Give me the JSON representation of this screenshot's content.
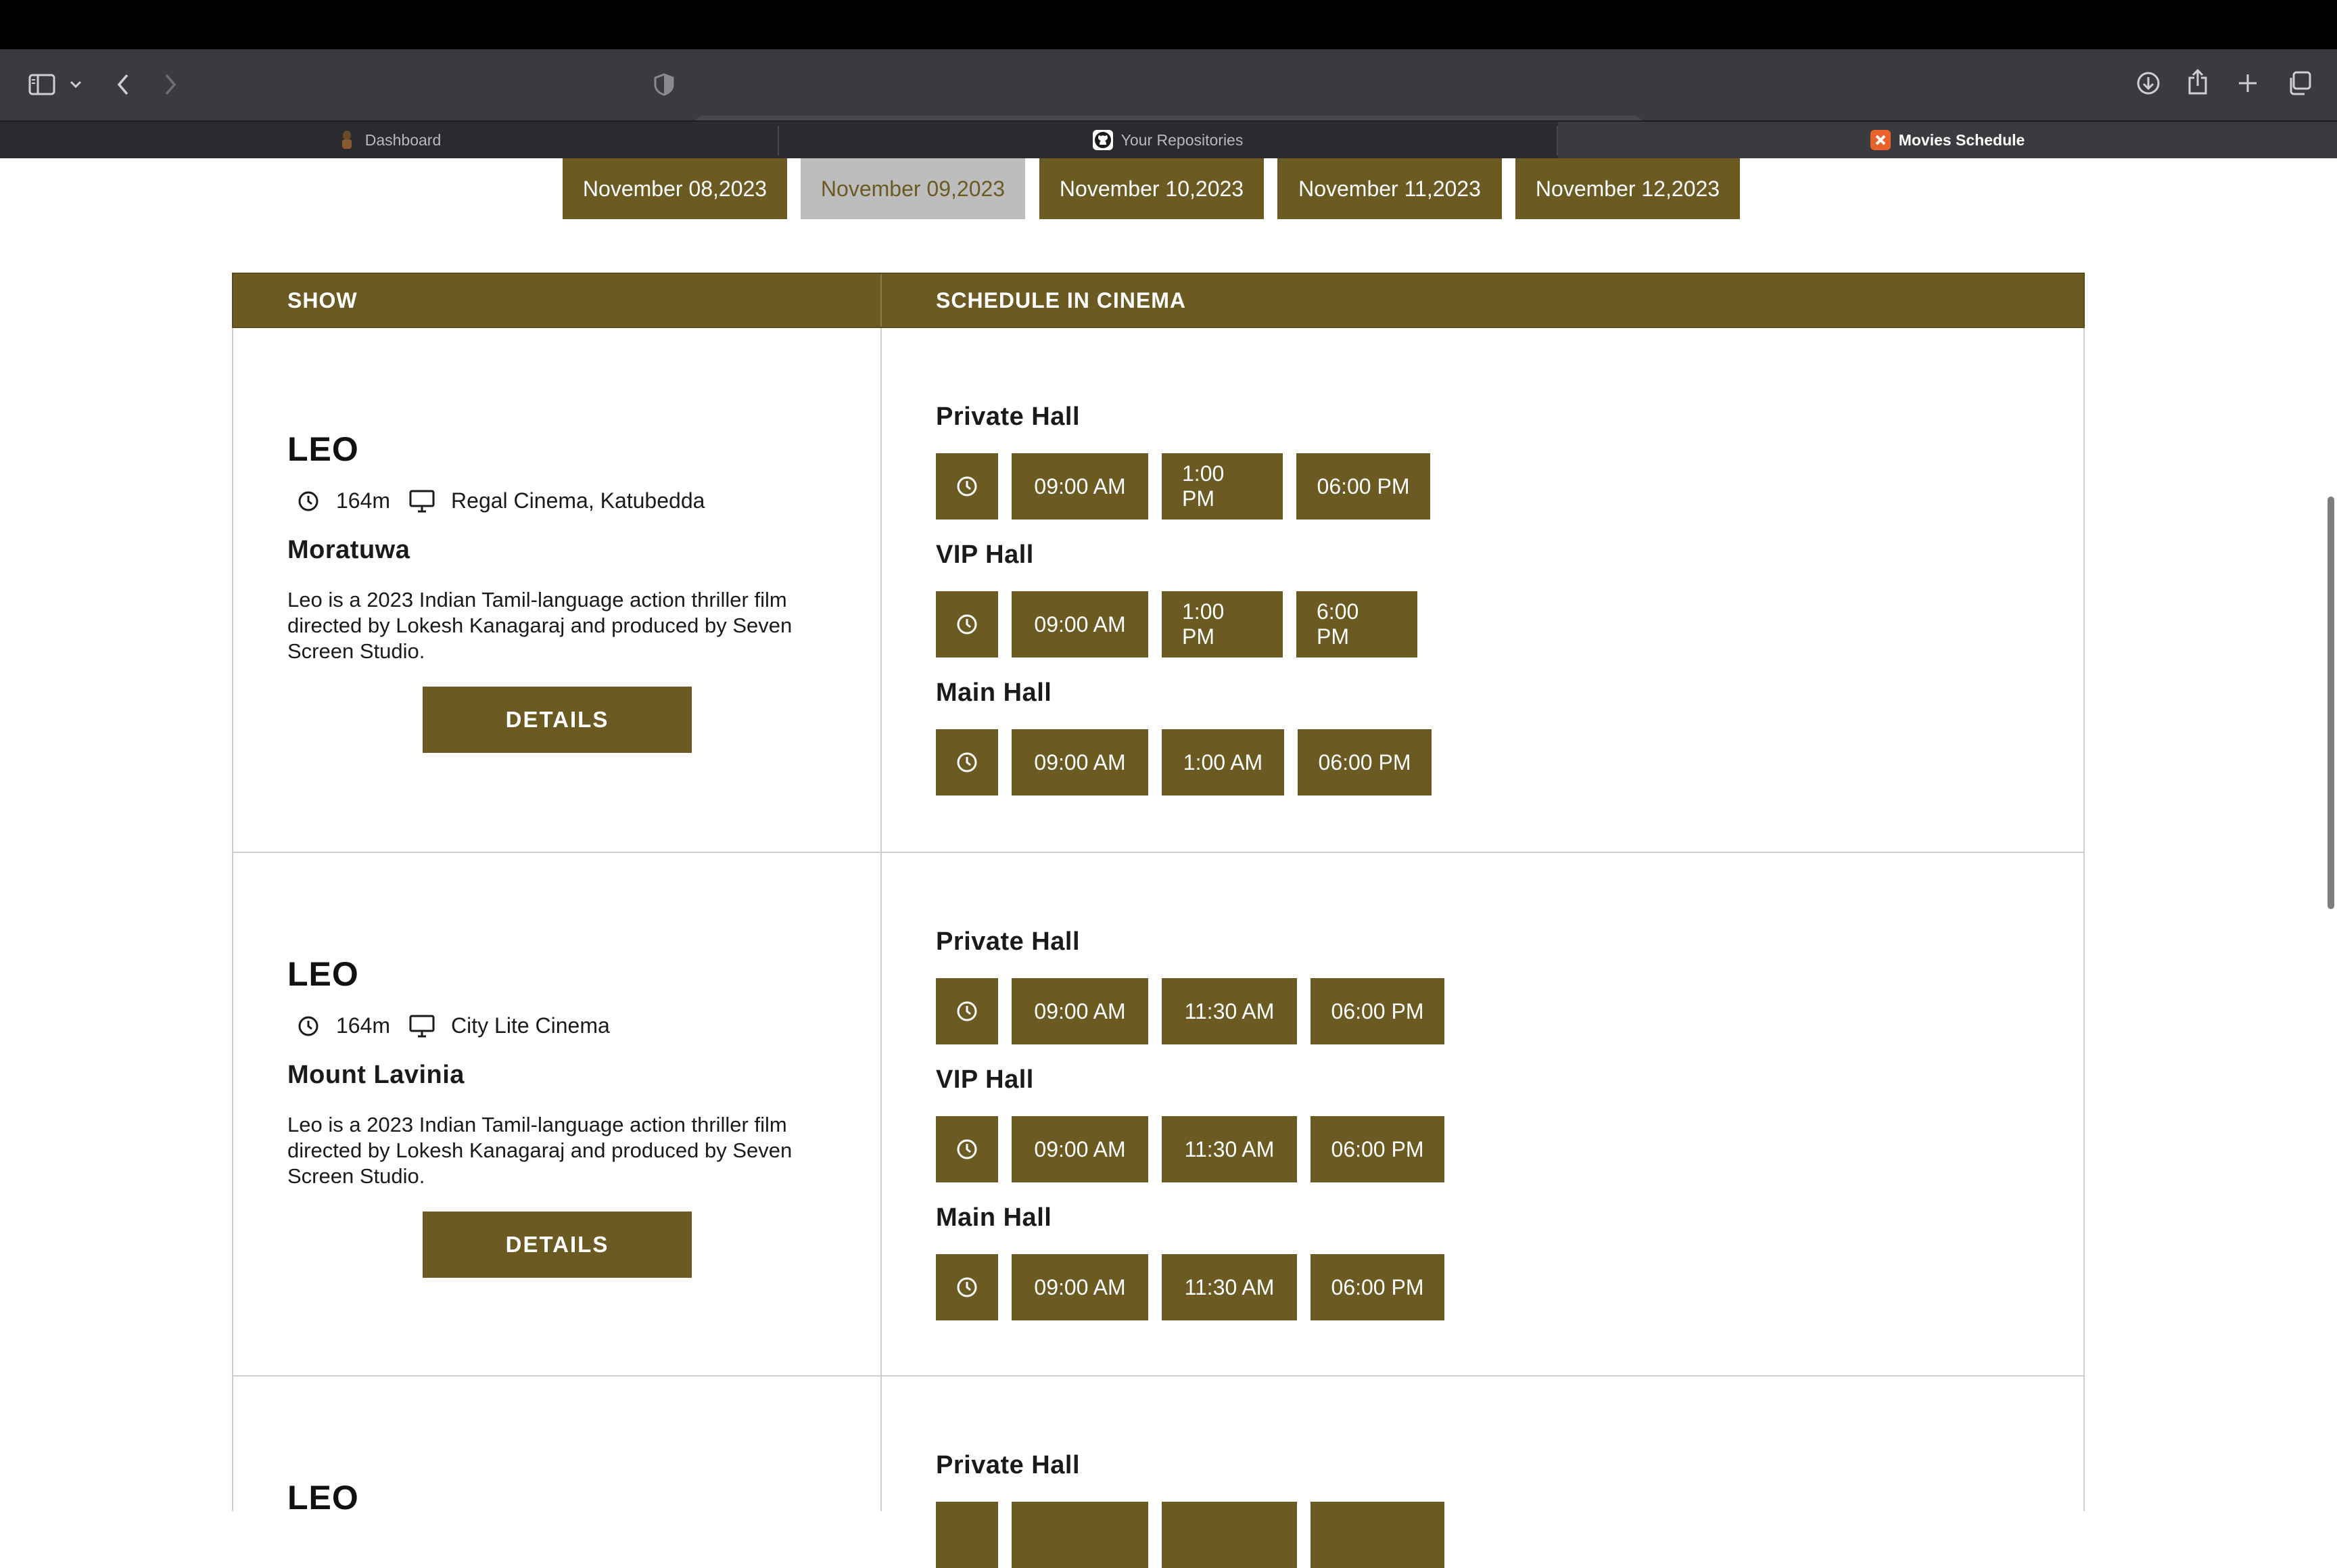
{
  "browser": {
    "url": "localhost",
    "tabs": [
      {
        "label": "Dashboard",
        "active": false
      },
      {
        "label": "Your Repositories",
        "active": false
      },
      {
        "label": "Movies Schedule",
        "active": true
      }
    ]
  },
  "dates": [
    {
      "label": "November 08,2023",
      "selected": false
    },
    {
      "label": "November 09,2023",
      "selected": true
    },
    {
      "label": "November 10,2023",
      "selected": false
    },
    {
      "label": "November 11,2023",
      "selected": false
    },
    {
      "label": "November 12,2023",
      "selected": false
    }
  ],
  "table": {
    "col_show": "SHOW",
    "col_schedule": "SCHEDULE IN CINEMA"
  },
  "shows": [
    {
      "title": "LEO",
      "duration": "164m",
      "cinema": "Regal Cinema, Katubedda",
      "city": "Moratuwa",
      "description": "Leo is a 2023 Indian Tamil-language action thriller film directed by Lokesh Kanagaraj and produced by Seven Screen Studio.",
      "details_label": "DETAILS",
      "halls": [
        {
          "name": "Private Hall",
          "times": [
            "09:00 AM",
            "1:00 PM",
            "06:00 PM"
          ]
        },
        {
          "name": "VIP Hall",
          "times": [
            "09:00 AM",
            "1:00 PM",
            "6:00 PM"
          ]
        },
        {
          "name": "Main Hall",
          "times": [
            "09:00 AM",
            "1:00 AM",
            "06:00 PM"
          ]
        }
      ]
    },
    {
      "title": "LEO",
      "duration": "164m",
      "cinema": "City Lite Cinema",
      "city": "Mount Lavinia",
      "description": "Leo is a 2023 Indian Tamil-language action thriller film directed by Lokesh Kanagaraj and produced by Seven Screen Studio.",
      "details_label": "DETAILS",
      "halls": [
        {
          "name": "Private Hall",
          "times": [
            "09:00 AM",
            "11:30 AM",
            "06:00 PM"
          ]
        },
        {
          "name": "VIP Hall",
          "times": [
            "09:00 AM",
            "11:30 AM",
            "06:00 PM"
          ]
        },
        {
          "name": "Main Hall",
          "times": [
            "09:00 AM",
            "11:30 AM",
            "06:00 PM"
          ]
        }
      ]
    },
    {
      "title": "LEO",
      "halls": [
        {
          "name": "Private Hall"
        }
      ]
    }
  ],
  "colors": {
    "accent": "#6b5a22",
    "selected_date_bg": "#bdbdbd",
    "chrome_dark": "#3b3a3f"
  }
}
